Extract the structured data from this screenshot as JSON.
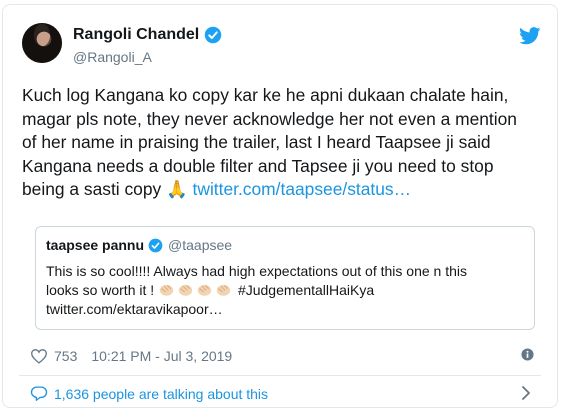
{
  "author": {
    "name": "Rangoli Chandel",
    "handle": "@Rangoli_A",
    "verified": true
  },
  "tweet": {
    "text_main": "Kuch log Kangana ko copy kar ke he apni dukaan chalate hain,\nmagar pls note, they never acknowledge her not even a mention\nof her name in praising the trailer, last I heard Taapsee ji said\nKangana needs a double filter and Tapsee ji you need to stop\nbeing a sasti copy ",
    "emoji": "🙏",
    "link": "twitter.com/taapsee/status…"
  },
  "quoted_tweet": {
    "name": "taapsee pannu",
    "handle": "@taapsee",
    "verified": true,
    "text_line1": "This is so cool!!!! Always had high expectations out of this one n this",
    "text_line2_start": "looks so worth it ! ",
    "hashtag": "#JudgementallHaiKya",
    "link": "twitter.com/ektaravikapoor…"
  },
  "meta": {
    "likes": "753",
    "timestamp": "10:21 PM - Jul 3, 2019"
  },
  "footer": {
    "talking": "1,636 people are talking about this"
  },
  "colors": {
    "brand_blue": "#1da1f2",
    "link_blue": "#1b95e0",
    "muted_gray": "#657786",
    "border": "#e1e8ed"
  },
  "icons": [
    "verified-badge-icon",
    "twitter-bird-icon",
    "heart-icon",
    "info-icon",
    "comment-icon",
    "chevron-right-icon",
    "clapping-hands-icon",
    "folded-hands-icon"
  ]
}
